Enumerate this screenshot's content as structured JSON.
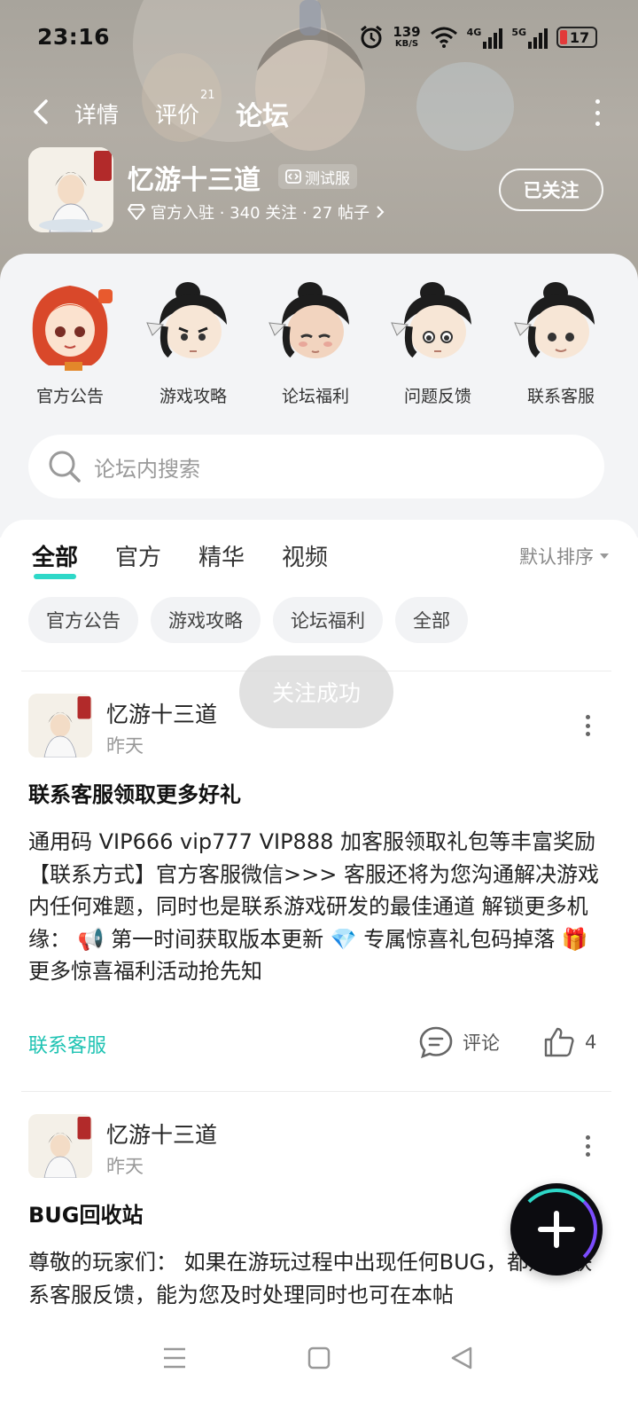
{
  "status_bar": {
    "time": "23:16",
    "net_speed_value": "139",
    "net_speed_unit": "KB/S",
    "signal1_label": "4G",
    "signal2_label": "5G",
    "battery": "17"
  },
  "nav": {
    "tabs": [
      {
        "label": "详情"
      },
      {
        "label": "评价",
        "badge": "21"
      },
      {
        "label": "论坛"
      }
    ],
    "active_tab": "论坛"
  },
  "game": {
    "title": "忆游十三道",
    "badge": "测试服",
    "meta": "官方入驻 · 340 关注 · 27 帖子",
    "follow_label": "已关注"
  },
  "categories": [
    {
      "label": "官方公告"
    },
    {
      "label": "游戏攻略"
    },
    {
      "label": "论坛福利"
    },
    {
      "label": "问题反馈"
    },
    {
      "label": "联系客服"
    }
  ],
  "search": {
    "placeholder": "论坛内搜索"
  },
  "filter_tabs": [
    "全部",
    "官方",
    "精华",
    "视频"
  ],
  "sort_label": "默认排序",
  "chips": [
    "官方公告",
    "游戏攻略",
    "论坛福利",
    "全部"
  ],
  "toast": "关注成功",
  "posts": [
    {
      "author": "忆游十三道",
      "time": "昨天",
      "title": "联系客服领取更多好礼",
      "body": "通用码 VIP666 vip777 VIP888 加客服领取礼包等丰富奖励 【联系方式】官方客服微信>>> 客服还将为您沟通解决游戏内任何难题，同时也是联系游戏研发的最佳通道 解锁更多机缘： 📢 第一时间获取版本更新 💎 专属惊喜礼包码掉落 🎁 更多惊喜福利活动抢先知",
      "tag": "联系客服",
      "comment_label": "评论",
      "likes": "4"
    },
    {
      "author": "忆游十三道",
      "time": "昨天",
      "title": "BUG回收站",
      "body": "尊敬的玩家们：  如果在游玩过程中出现任何BUG，都建议联系客服反馈，能为您及时处理同时也可在本帖"
    }
  ],
  "colors": {
    "accent": "#2ed8c8",
    "link": "#1fc3b3"
  }
}
